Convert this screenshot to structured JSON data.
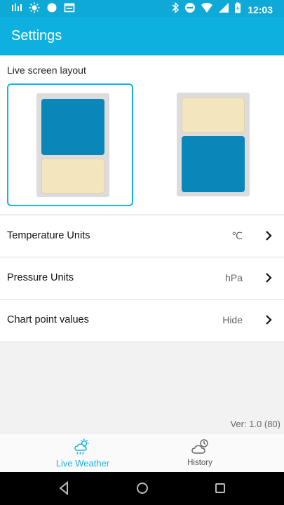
{
  "status_bar": {
    "time": "12:03",
    "icons_left": [
      "signal-bars-icon",
      "sun-icon",
      "circle-icon",
      "calendar-icon"
    ],
    "icons_right": [
      "bluetooth-icon",
      "do-not-disturb-icon",
      "wifi-icon",
      "cellular-icon",
      "battery-icon"
    ]
  },
  "app_bar": {
    "title": "Settings"
  },
  "layout_section": {
    "label": "Live screen layout",
    "options": [
      {
        "id": "large-top",
        "selected": true
      },
      {
        "id": "large-bottom",
        "selected": false
      }
    ]
  },
  "settings": [
    {
      "label": "Temperature Units",
      "value": "℃"
    },
    {
      "label": "Pressure Units",
      "value": "hPa"
    },
    {
      "label": "Chart point values",
      "value": "Hide"
    }
  ],
  "version": "Ver: 1.0 (80)",
  "bottom_nav": {
    "items": [
      {
        "label": "Live Weather",
        "icon": "weather-icon",
        "active": true
      },
      {
        "label": "History",
        "icon": "history-icon",
        "active": false
      }
    ]
  },
  "colors": {
    "status_bar": "#0ea9d6",
    "app_bar": "#0eb0e0",
    "accent": "#14b4e3",
    "block_blue": "#0b86b9",
    "block_beige": "#f3e6bf"
  }
}
